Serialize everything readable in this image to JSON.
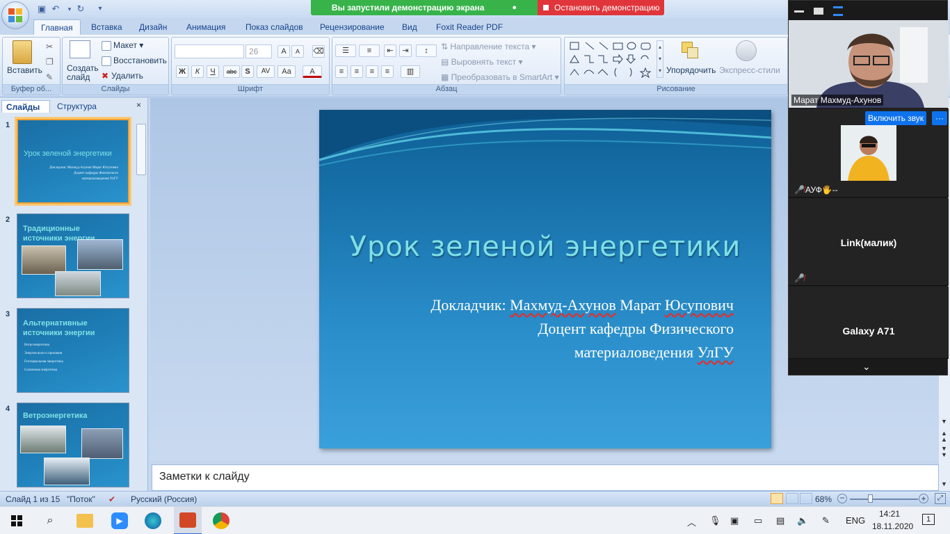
{
  "share_bar": {
    "label": "Вы запустили демонстрацию экрана",
    "stop_label": "Остановить демонстрацию"
  },
  "tabs": [
    "Главная",
    "Вставка",
    "Дизайн",
    "Анимация",
    "Показ слайдов",
    "Рецензирование",
    "Вид",
    "Foxit Reader PDF"
  ],
  "ribbon": {
    "clipboard": {
      "paste": "Вставить",
      "label": "Буфер об..."
    },
    "slides": {
      "new_slide": "Создать слайд",
      "layout": "Макет",
      "reset": "Восстановить",
      "delete": "Удалить",
      "label": "Слайды"
    },
    "font": {
      "font_size": "26",
      "label": "Шрифт",
      "bold": "Ж",
      "italic": "К",
      "underline": "Ч",
      "strike": "abc",
      "shadow": "S",
      "spacing": "AV",
      "case": "Aa",
      "color": "A"
    },
    "paragraph": {
      "text_direction": "Направление текста",
      "align_text": "Выровнять текст",
      "smartart": "Преобразовать в SmartArt",
      "label": "Абзац"
    },
    "drawing": {
      "arrange": "Упорядочить",
      "quick_styles": "Экспресс-стили",
      "label": "Рисование"
    }
  },
  "left_pane": {
    "tab_slides": "Слайды",
    "tab_outline": "Структура",
    "close": "×"
  },
  "thumbnails": [
    {
      "num": "1",
      "title": "Урок зеленой энергетики",
      "lines": [
        "Докладчик: Махмуд-Ахунов Марат Юсупович",
        "Доцент кафедры Физического",
        "материаловедения УлГУ"
      ]
    },
    {
      "num": "2",
      "title": "Традиционные  источники энергии",
      "lines": []
    },
    {
      "num": "3",
      "title": "Альтернативные источники энергии",
      "lines": [
        "Ветроэнергетика",
        "Энергия волн и приливов",
        "Геотермальная энергетика",
        "Солнечная энергетика"
      ]
    },
    {
      "num": "4",
      "title": "Ветроэнергетика",
      "lines": []
    }
  ],
  "slide": {
    "title": "Урок зеленой энергетики",
    "line1_prefix": "Докладчик:",
    "line1_name1": "Махмуд-Ахунов",
    "line1_name2": "Марат",
    "line1_name3": "Юсупович",
    "line2": "Доцент кафедры Физического",
    "line3_a": "материаловедения",
    "line3_b": "УлГУ"
  },
  "notes_placeholder": "Заметки к слайду",
  "status": {
    "slide_of": "Слайд 1 из 15",
    "theme": "\"Поток\"",
    "language": "Русский (Россия)",
    "zoom": "68%"
  },
  "zoom_panel": {
    "speaker_name": "Марат Махмуд-Ахунов",
    "unmute_label": "Включить звук",
    "more_label": "···",
    "participants": [
      {
        "name": "АУФ🖐--"
      },
      {
        "name": "Link(малик)"
      },
      {
        "name": "Galaxy A71"
      }
    ]
  },
  "taskbar": {
    "lang": "ENG",
    "time": "14:21",
    "date": "18.11.2020",
    "notif": "1"
  }
}
